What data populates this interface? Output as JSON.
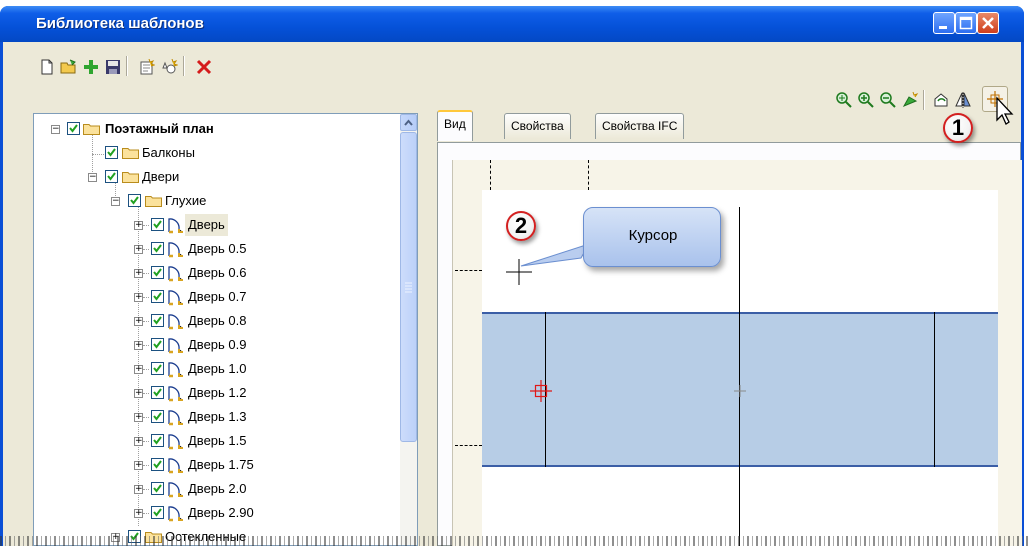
{
  "window": {
    "title": "Библиотека шаблонов"
  },
  "toolbar_left": {
    "icons": [
      "new-icon",
      "open-folder-icon",
      "add-icon",
      "save-icon",
      "new-item-icon",
      "new-item-star-icon",
      "delete-icon"
    ]
  },
  "toolbar_right": {
    "icons": [
      "zoom-fit-icon",
      "zoom-in-icon",
      "zoom-out-icon",
      "pan-icon",
      "rotate-icon",
      "mirror-icon",
      "cursor-point-icon"
    ]
  },
  "tree": {
    "root": "Поэтажный план",
    "balconies": "Балконы",
    "doors": "Двери",
    "solid": "Глухие",
    "items": [
      "Дверь",
      "Дверь 0.5",
      "Дверь 0.6",
      "Дверь 0.7",
      "Дверь 0.8",
      "Дверь 0.9",
      "Дверь 1.0",
      "Дверь 1.2",
      "Дверь 1.3",
      "Дверь 1.5",
      "Дверь 1.75",
      "Дверь 2.0",
      "Дверь 2.90"
    ],
    "glazed": "Остекленные"
  },
  "tabs": [
    "Вид",
    "Свойства",
    "Свойства IFC"
  ],
  "callouts": {
    "one": "1",
    "two": "2",
    "cursor_label": "Курсор"
  },
  "colors": {
    "title_bar": "#0551d8",
    "band": "#b7cde6",
    "band_border": "#3b5ea6",
    "callout_ring": "#d32020"
  }
}
